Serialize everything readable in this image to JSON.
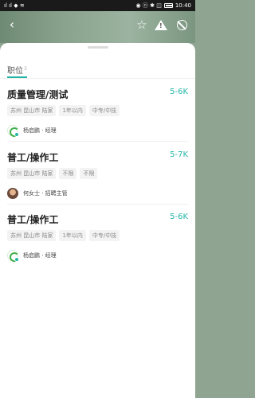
{
  "status_bar": {
    "left_indicators": "ıl  ıl  ◆  ≋",
    "right_indicators": "◉ ⓝ ✱ ◫",
    "time": "10:40"
  },
  "header": {
    "back_icon": "chevron-left-icon",
    "star_icon": "star-icon",
    "warning_icon": "warning-icon",
    "block_icon": "block-icon"
  },
  "tabs": [
    {
      "label": "职位",
      "count": "3"
    }
  ],
  "jobs": [
    {
      "title": "质量管理/测试",
      "salary": "5-6K",
      "tags": [
        "苏州 昆山市 陆家",
        "1年以内",
        "中专/中技"
      ],
      "recruiter": "杨启鹏 · 经理",
      "avatar_type": "logo"
    },
    {
      "title": "普工/操作工",
      "salary": "5-7K",
      "tags": [
        "苏州 昆山市 陆家",
        "不限",
        "不限"
      ],
      "recruiter": "何女士 · 招聘主管",
      "avatar_type": "photo"
    },
    {
      "title": "普工/操作工",
      "salary": "5-6K",
      "tags": [
        "苏州 昆山市 陆家",
        "1年以内",
        "中专/中技"
      ],
      "recruiter": "杨启鹏 · 经理",
      "avatar_type": "logo"
    }
  ],
  "colors": {
    "accent": "#23b6a6",
    "title": "#222222",
    "tag_bg": "#f3f3f3"
  }
}
